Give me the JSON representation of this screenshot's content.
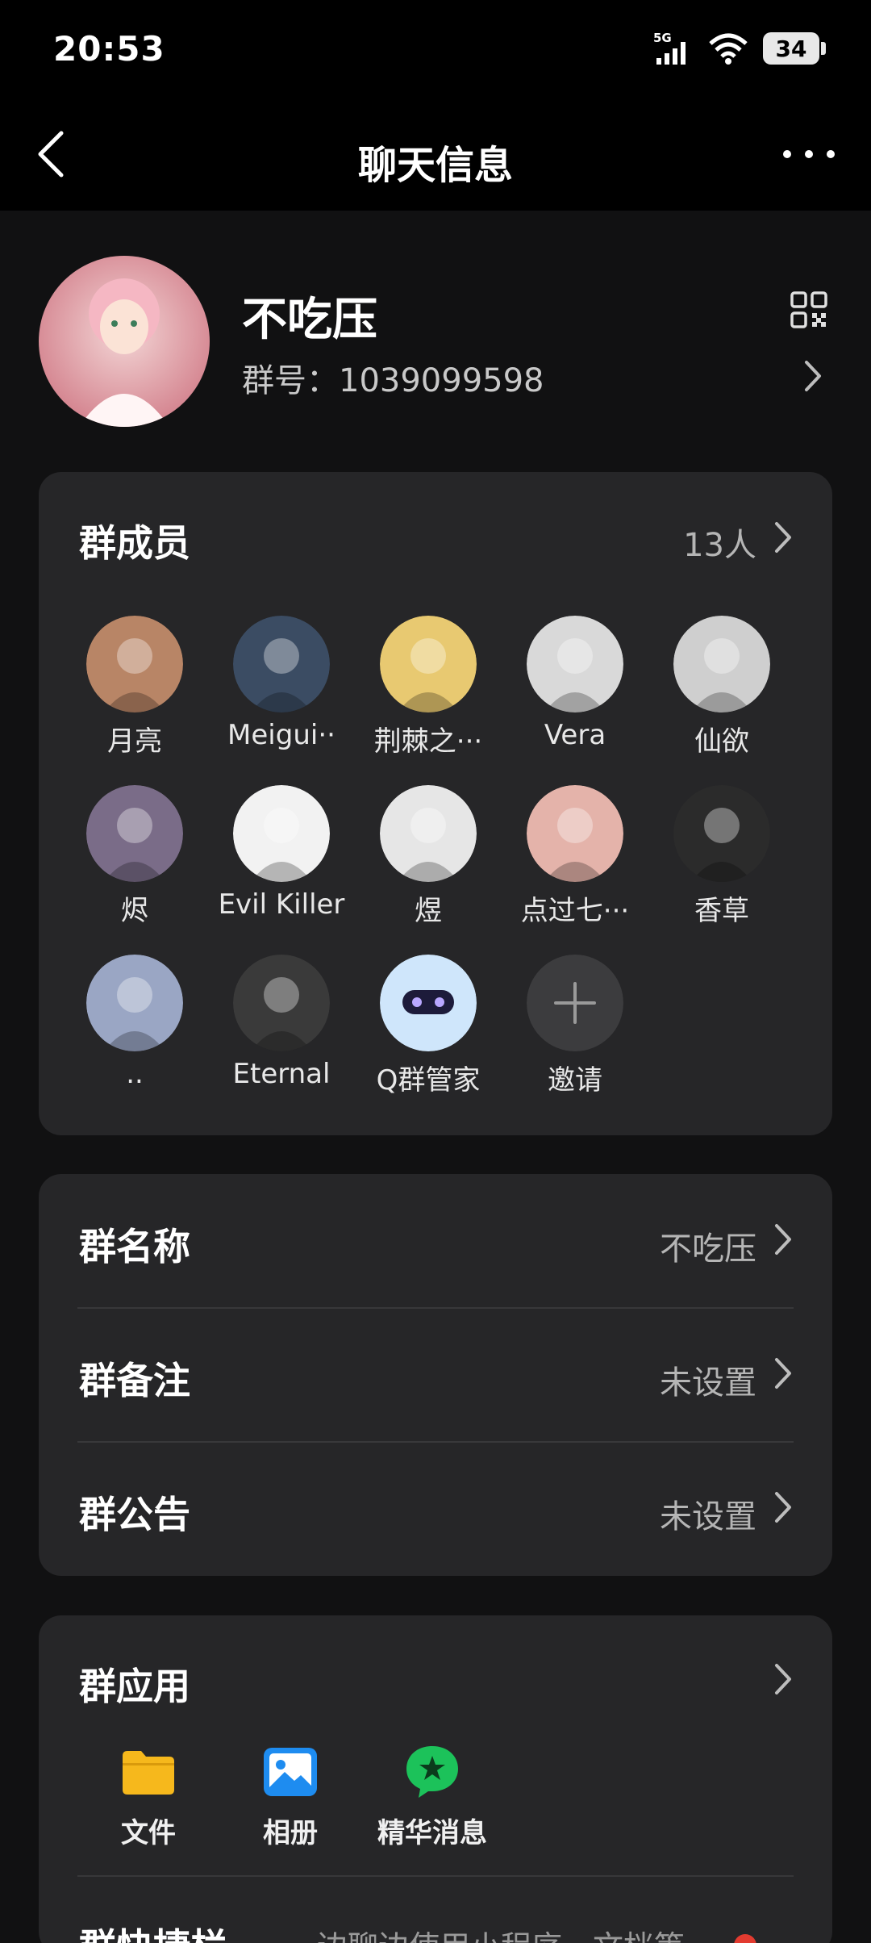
{
  "status_bar": {
    "time": "20:53",
    "network": "5G",
    "battery": "34"
  },
  "nav": {
    "title": "聊天信息"
  },
  "group": {
    "name": "不吃压",
    "number": "群号：1039099598"
  },
  "members": {
    "header": "群成员",
    "count": "13人",
    "list": [
      {
        "name": "月亮",
        "avatar": "#b88566"
      },
      {
        "name": "Meigui··",
        "avatar": "#3b4c63"
      },
      {
        "name": "荆棘之···",
        "avatar": "#e8c971"
      },
      {
        "name": "Vera",
        "avatar": "#d9d9d9"
      },
      {
        "name": "仙欲",
        "avatar": "#cfcfcf"
      },
      {
        "name": "烬",
        "avatar": "#7a6c88"
      },
      {
        "name": "Evil Killer",
        "avatar": "#f2f2f2"
      },
      {
        "name": "煜",
        "avatar": "#e6e6e6"
      },
      {
        "name": "点过七···",
        "avatar": "#e4b3aa"
      },
      {
        "name": "香草",
        "avatar": "#2b2b2b"
      },
      {
        "name": "..",
        "avatar": "#9aa6c4"
      },
      {
        "name": "Eternal",
        "avatar": "#3a3a3a"
      },
      {
        "name": "Q群管家",
        "avatar": "#cfe6fb"
      },
      {
        "name": "邀请",
        "avatar": "#3c3c3e"
      }
    ]
  },
  "settings": [
    {
      "label": "群名称",
      "value": "不吃压"
    },
    {
      "label": "群备注",
      "value": "未设置"
    },
    {
      "label": "群公告",
      "value": "未设置"
    }
  ],
  "apps": {
    "header": "群应用",
    "items": [
      {
        "label": "文件",
        "icon": "folder-icon",
        "color": "#f6b81c"
      },
      {
        "label": "相册",
        "icon": "image-icon",
        "color": "#1e8cf0"
      },
      {
        "label": "精华消息",
        "icon": "star-bubble-icon",
        "color": "#1cc25a"
      }
    ],
    "quick_label": "群快捷栏",
    "quick_value": "边聊边使用小程序、文档等"
  },
  "colors": {
    "background": "#111112",
    "card": "#262628",
    "accent_red": "#e23b30"
  }
}
